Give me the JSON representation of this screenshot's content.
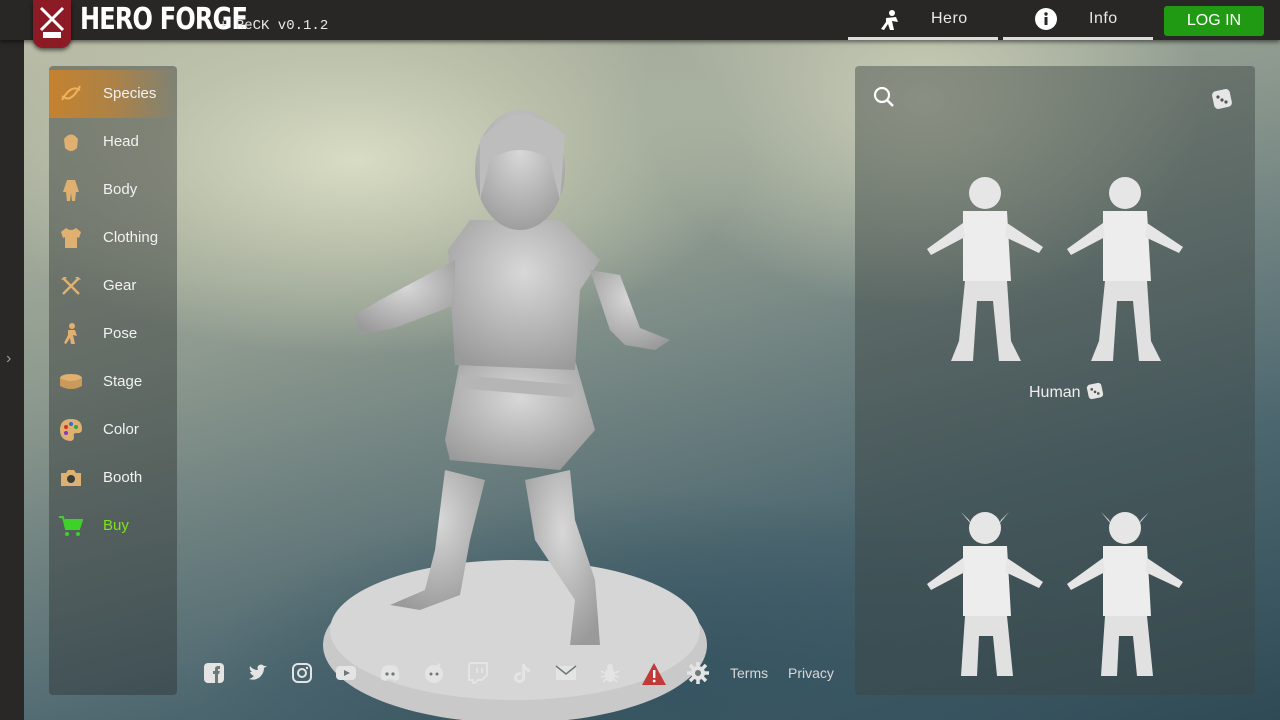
{
  "app": {
    "logo_text": "HERO FORGE",
    "version": "+ ReCK v0.1.2"
  },
  "tabs": [
    {
      "label": "Hero",
      "icon": "hero-icon"
    },
    {
      "label": "Info",
      "icon": "info-icon"
    }
  ],
  "login_label": "LOG IN",
  "menu": [
    {
      "label": "Species",
      "icon": "dna-icon",
      "active": true
    },
    {
      "label": "Head",
      "icon": "head-icon"
    },
    {
      "label": "Body",
      "icon": "body-icon"
    },
    {
      "label": "Clothing",
      "icon": "shirt-icon"
    },
    {
      "label": "Gear",
      "icon": "crossed-axes-icon"
    },
    {
      "label": "Pose",
      "icon": "pose-icon"
    },
    {
      "label": "Stage",
      "icon": "stage-base-icon"
    },
    {
      "label": "Color",
      "icon": "palette-icon"
    },
    {
      "label": "Booth",
      "icon": "camera-icon"
    },
    {
      "label": "Buy",
      "icon": "cart-icon"
    }
  ],
  "species_panel": {
    "group_label": "Human"
  },
  "footer": {
    "icons": [
      "facebook-icon",
      "twitter-icon",
      "instagram-icon",
      "youtube-icon",
      "discord-icon",
      "reddit-icon",
      "twitch-icon",
      "tiktok-icon",
      "mail-icon",
      "bug-icon",
      "warning-icon",
      "settings-icon"
    ],
    "terms": "Terms",
    "privacy": "Privacy"
  },
  "colors": {
    "accent": "#cd8228",
    "login": "#1f9a12",
    "buy": "#7fe21c",
    "logo_red": "#8c1b26"
  }
}
